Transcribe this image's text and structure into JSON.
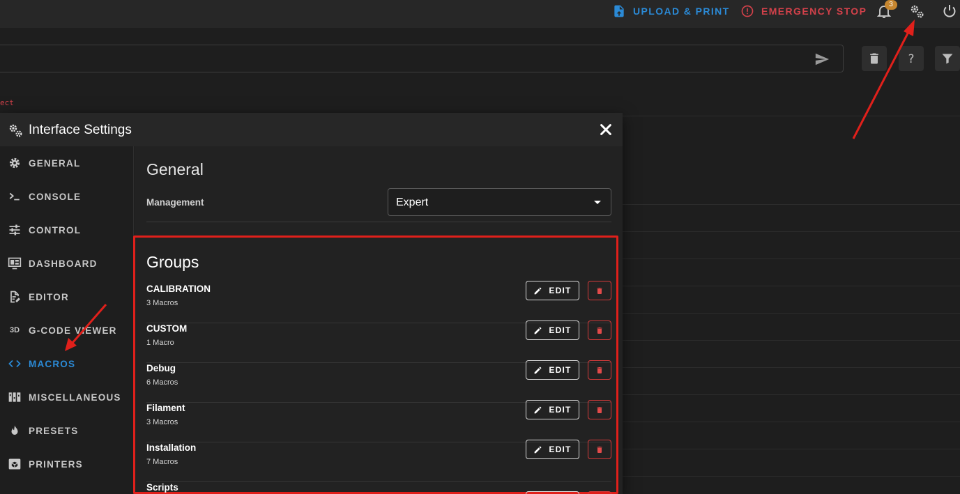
{
  "topbar": {
    "upload_label": "UPLOAD & PRINT",
    "estop_label": "EMERGENCY STOP",
    "notification_count": "3",
    "icons": [
      "upload-file-icon",
      "alert-circle-icon",
      "bell-icon",
      "gears-icon",
      "power-icon"
    ]
  },
  "console": {
    "log_text": "ect",
    "icons": [
      "send-icon",
      "trash-icon",
      "help-icon",
      "filter-icon"
    ]
  },
  "dialog": {
    "title": "Interface Settings",
    "nav": [
      {
        "label": "GENERAL",
        "icon": "gear-icon"
      },
      {
        "label": "CONSOLE",
        "icon": "console-icon"
      },
      {
        "label": "CONTROL",
        "icon": "sliders-icon"
      },
      {
        "label": "DASHBOARD",
        "icon": "monitor-dashboard-icon"
      },
      {
        "label": "EDITOR",
        "icon": "file-edit-icon"
      },
      {
        "label": "G-CODE VIEWER",
        "icon": "3d-icon"
      },
      {
        "label": "MACROS",
        "icon": "code-brackets-icon",
        "active": true
      },
      {
        "label": "MISCELLANEOUS",
        "icon": "miscellaneous-icon"
      },
      {
        "label": "PRESETS",
        "icon": "fire-icon"
      },
      {
        "label": "PRINTERS",
        "icon": "printer-3d-icon"
      }
    ],
    "general": {
      "heading": "General",
      "management_label": "Management",
      "management_value": "Expert"
    },
    "groups": {
      "heading": "Groups",
      "edit_label": "EDIT",
      "items": [
        {
          "name": "CALIBRATION",
          "count": "3 Macros"
        },
        {
          "name": "CUSTOM",
          "count": "1 Macro"
        },
        {
          "name": "Debug",
          "count": "6 Macros"
        },
        {
          "name": "Filament",
          "count": "3 Macros"
        },
        {
          "name": "Installation",
          "count": "7 Macros"
        },
        {
          "name": "Scripts",
          "count": ""
        }
      ]
    }
  },
  "colors": {
    "accent_blue": "#2b8ad6",
    "danger_red": "#d2414a",
    "annotation_red": "#e0201b",
    "badge": "#c6862f"
  }
}
